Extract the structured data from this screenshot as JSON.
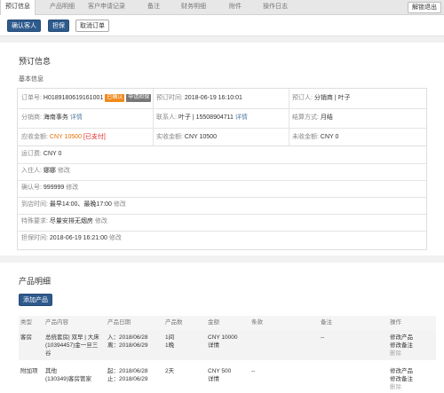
{
  "tabs": [
    "预订信息",
    "产品明细",
    "客户申请记录",
    "备注",
    "财务明细",
    "附件",
    "操作日志"
  ],
  "logout_label": "解锁退出",
  "toolbar": {
    "confirm": "确认客人",
    "guarantee": "担保",
    "cancel": "取消订单"
  },
  "booking": {
    "section_title": "预订信息",
    "basic_title": "基本信息",
    "order_no_label": "订单号:",
    "order_no": "H0189180619161001",
    "badge_confirmed": "已确认",
    "badge_apply": "申请担保",
    "book_time_label": "预订时间:",
    "book_time": "2018-06-19 16:10:01",
    "booker_label": "预订人:",
    "booker": "分销商 | 叶子",
    "distributor_label": "分销商:",
    "distributor": "海南事务",
    "detail": "详情",
    "contact_label": "联系人:",
    "contact": "叶子 | 15508904711",
    "settle_label": "结算方式:",
    "settle": "月结",
    "receivable_label": "应收金额:",
    "receivable": "CNY 10500",
    "paid_tag": "[已支付]",
    "received_label": "实收金额:",
    "received": "CNY 10500",
    "unreceived_label": "未收金额:",
    "unreceived": "CNY 0",
    "shipping_label": "运订费:",
    "shipping": "CNY 0",
    "guest_label": "入住人:",
    "guest": "娜娜",
    "edit": "修改",
    "confirm_no_label": "确认号:",
    "confirm_no": "999999",
    "arrival_label": "到店时间:",
    "arrival": "最早14:00、最晚17:00",
    "special_label": "特殊要求:",
    "special": "尽量安排无烟房",
    "guarantee_time_label": "担保时间:",
    "guarantee_time": "2018-06-19 16:21:00"
  },
  "products": {
    "section_title": "产品明细",
    "add_button": "添加产品",
    "headers": [
      "类型",
      "产品内容",
      "产品日期",
      "产品数",
      "金额",
      "条款",
      "备注",
      "操作"
    ],
    "rows": [
      {
        "type": "客房",
        "content1": "总统套房| 双早 | 大床",
        "content2": "(10394457)金一旦三",
        "content3": "谷",
        "date1": "入：2018/06/28",
        "date2": "离：2018/06/29",
        "qty1": "1间",
        "qty2": "1晚",
        "amount": "CNY 10000",
        "amount_detail": "详情",
        "terms": "",
        "remark": "--",
        "op1": "修改产品",
        "op2": "修改备注",
        "op3": "删除"
      },
      {
        "type": "附加项",
        "content1": "其他",
        "content2": "(130349)客房管家",
        "content3": "",
        "date1": "起：2018/06/28",
        "date2": "止：2018/06/29",
        "qty1": "2天",
        "qty2": "",
        "amount": "CNY 500",
        "amount_detail": "详情",
        "terms": "--",
        "remark": "",
        "op1": "修改产品",
        "op2": "修改备注",
        "op3": "删除"
      }
    ]
  },
  "colors": {
    "primary": "#2e5a8c",
    "accent_orange": "#e46d00",
    "badge_orange": "#f08a1c",
    "paid_red": "#dd2222"
  }
}
